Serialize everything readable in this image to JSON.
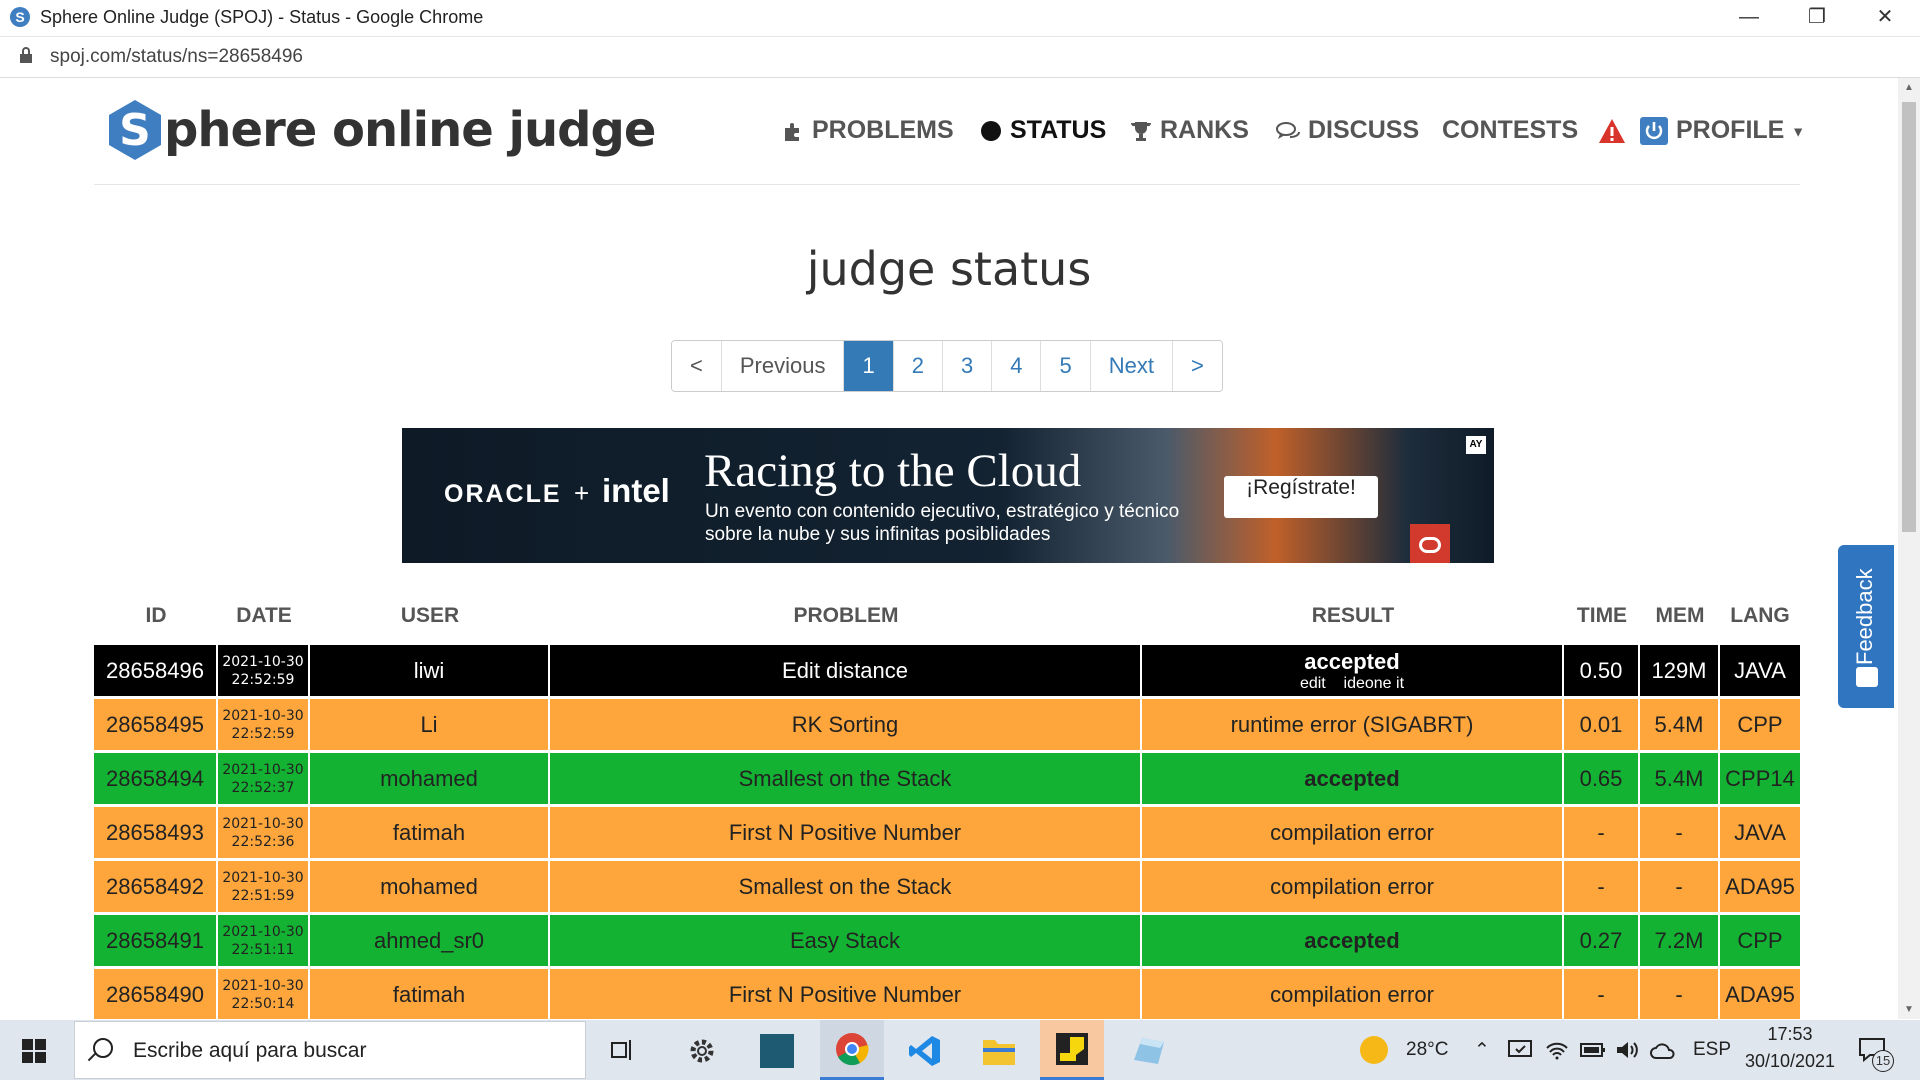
{
  "window": {
    "title": "Sphere Online Judge (SPOJ) - Status - Google Chrome",
    "url": "spoj.com/status/ns=28658496",
    "controls": [
      "minimize",
      "restore",
      "close"
    ]
  },
  "site": {
    "logo_text": "phere online judge",
    "logo_letter": "S",
    "nav": [
      {
        "label": "PROBLEMS",
        "icon": "puzzle-icon"
      },
      {
        "label": "STATUS",
        "icon": "circle-icon",
        "active": true
      },
      {
        "label": "RANKS",
        "icon": "trophy-icon"
      },
      {
        "label": "DISCUSS",
        "icon": "chat-icon"
      },
      {
        "label": "CONTESTS"
      },
      {
        "label": "PROFILE",
        "icon": "power-icon"
      }
    ]
  },
  "page": {
    "heading": "judge status"
  },
  "pagination": {
    "first": "<",
    "previous": "Previous",
    "pages": [
      "1",
      "2",
      "3",
      "4",
      "5"
    ],
    "current": "1",
    "next": "Next",
    "last": ">"
  },
  "ad": {
    "brand1": "ORACLE",
    "plus": "+",
    "brand2": "intel",
    "headline": "Racing to the Cloud",
    "subline": "Un evento con contenido ejecutivo, estratégico y técnico sobre la nube y sus infinitas posiblidades",
    "cta": "¡Regístrate!",
    "adchoice": "AY"
  },
  "table": {
    "headers": [
      "ID",
      "DATE",
      "USER",
      "PROBLEM",
      "RESULT",
      "TIME",
      "MEM",
      "LANG"
    ],
    "rows": [
      {
        "style": "black",
        "id": "28658496",
        "date": "2021-10-30",
        "time_of_day": "22:52:59",
        "user": "liwi",
        "problem": "Edit distance",
        "result": "accepted",
        "result_links": "edit    ideone it",
        "time": "0.50",
        "mem": "129M",
        "lang": "JAVA"
      },
      {
        "style": "orange",
        "id": "28658495",
        "date": "2021-10-30",
        "time_of_day": "22:52:59",
        "user": "Li",
        "problem": "RK Sorting",
        "result": "runtime error (SIGABRT)",
        "time": "0.01",
        "mem": "5.4M",
        "lang": "CPP"
      },
      {
        "style": "green",
        "id": "28658494",
        "date": "2021-10-30",
        "time_of_day": "22:52:37",
        "user": "mohamed",
        "problem": "Smallest on the Stack",
        "result": "accepted",
        "time": "0.65",
        "mem": "5.4M",
        "lang": "CPP14"
      },
      {
        "style": "orange",
        "id": "28658493",
        "date": "2021-10-30",
        "time_of_day": "22:52:36",
        "user": "fatimah",
        "problem": "First N Positive Number",
        "result": "compilation error",
        "time": "-",
        "mem": "-",
        "lang": "JAVA"
      },
      {
        "style": "orange",
        "id": "28658492",
        "date": "2021-10-30",
        "time_of_day": "22:51:59",
        "user": "mohamed",
        "problem": "Smallest on the Stack",
        "result": "compilation error",
        "time": "-",
        "mem": "-",
        "lang": "ADA95"
      },
      {
        "style": "green",
        "id": "28658491",
        "date": "2021-10-30",
        "time_of_day": "22:51:11",
        "user": "ahmed_sr0",
        "problem": "Easy Stack",
        "result": "accepted",
        "time": "0.27",
        "mem": "7.2M",
        "lang": "CPP"
      },
      {
        "style": "orange",
        "id": "28658490",
        "date": "2021-10-30",
        "time_of_day": "22:50:14",
        "user": "fatimah",
        "problem": "First N Positive Number",
        "result": "compilation error",
        "time": "-",
        "mem": "-",
        "lang": "ADA95"
      }
    ]
  },
  "feedback": {
    "label": "Feedback"
  },
  "taskbar": {
    "search_placeholder": "Escribe aquí para buscar",
    "weather": "28°C",
    "language": "ESP",
    "clock_time": "17:53",
    "clock_date": "30/10/2021",
    "notifications": "15"
  },
  "colors": {
    "accepted": "#14b232",
    "error": "#fea63c",
    "current": "#000000",
    "link": "#337ab7"
  }
}
